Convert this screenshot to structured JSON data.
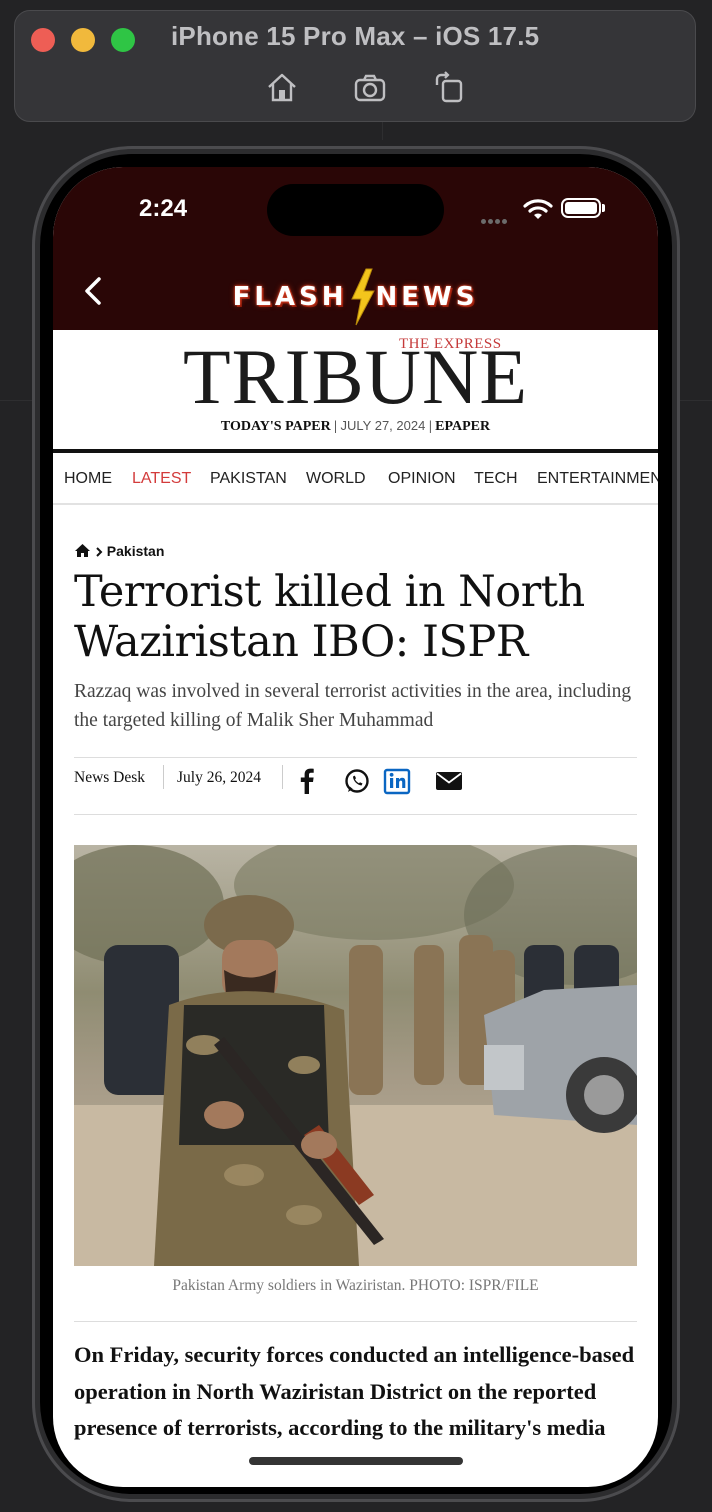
{
  "simulator": {
    "title": "iPhone 15 Pro Max – iOS 17.5",
    "tools": [
      "home-icon",
      "screenshot-icon",
      "rotate-icon"
    ]
  },
  "status_bar": {
    "time": "2:24"
  },
  "app": {
    "brand_left": "FLASH",
    "brand_right": "NEWS",
    "back_icon": "chevron-left-icon"
  },
  "masthead": {
    "the_express": "THE EXPRESS",
    "tribune": "TRIBUNE",
    "todays_paper": "TODAY'S PAPER",
    "date": "JULY 27, 2024",
    "epaper": "EPAPER",
    "sep": "|"
  },
  "nav": {
    "items": [
      {
        "label": "HOME"
      },
      {
        "label": "LATEST"
      },
      {
        "label": "PAKISTAN"
      },
      {
        "label": "WORLD"
      },
      {
        "label": "OPINION"
      },
      {
        "label": "TECH"
      },
      {
        "label": "ENTERTAINMENT"
      }
    ],
    "active": "LATEST"
  },
  "article": {
    "breadcrumb": "Pakistan",
    "headline": "Terrorist killed in North Waziristan IBO: ISPR",
    "standfirst": "Razzaq was involved in several terrorist activities in the area, including the targeted killing of Malik Sher Muhammad",
    "author": "News Desk",
    "date": "July 26, 2024",
    "share_icons": [
      "facebook-icon",
      "whatsapp-icon",
      "linkedin-icon",
      "email-icon"
    ],
    "caption": "Pakistan Army soldiers in Waziristan. PHOTO: ISPR/FILE",
    "body": "On Friday, security forces conducted an intelligence-based operation in North Waziristan District on the reported presence of terrorists, according to the military's media"
  },
  "colors": {
    "app_header": "#2a0606",
    "nav_active": "#d33b3b",
    "the_express": "#c53a3a",
    "linkedin": "#0a66c2"
  }
}
